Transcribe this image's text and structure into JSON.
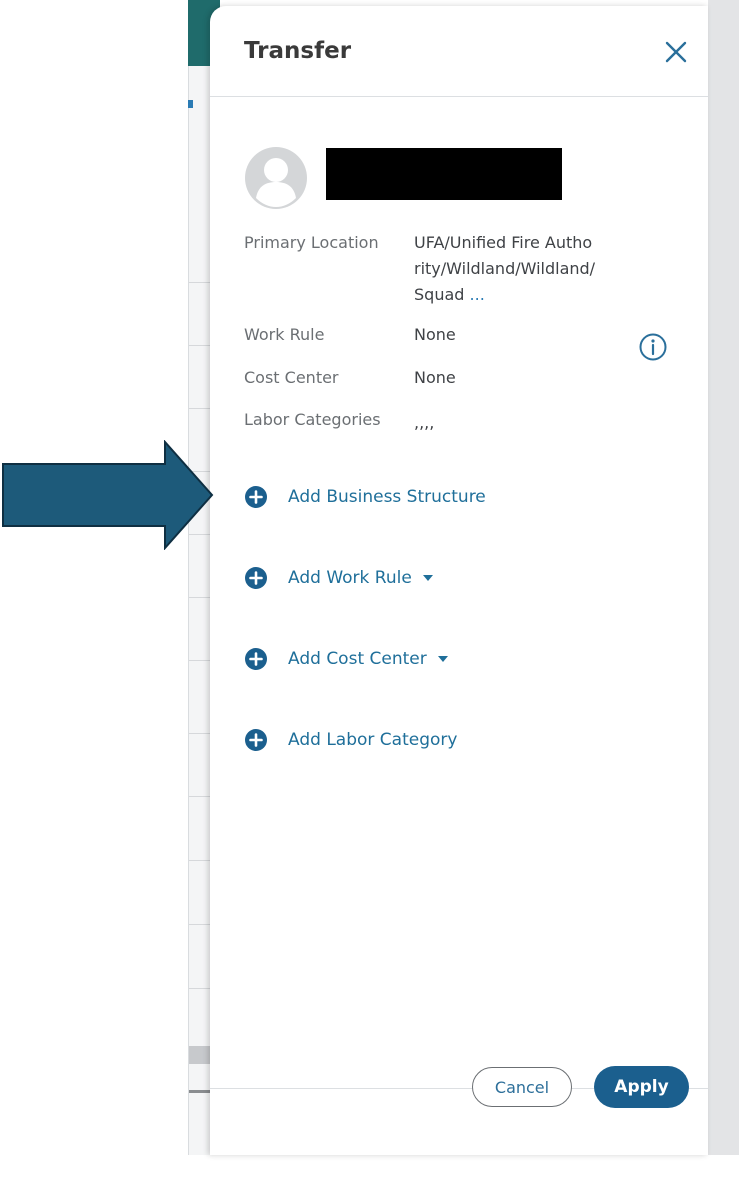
{
  "panel": {
    "title": "Transfer",
    "close_icon": "close-icon"
  },
  "employee": {
    "avatar_icon": "user-avatar-icon",
    "name": "",
    "fields": {
      "primary_location_label": "Primary Location",
      "primary_location_value_lines": [
        "UFA/Unified Fire Autho",
        "rity/Wildland/Wildland/",
        "Squad"
      ],
      "primary_location_more": "...",
      "work_rule_label": "Work Rule",
      "work_rule_value": "None",
      "cost_center_label": "Cost Center",
      "cost_center_value": "None",
      "labor_categories_label": "Labor Categories",
      "labor_categories_value": ",,,,"
    },
    "info_icon": "info-icon"
  },
  "actions": [
    {
      "label": "Add Business Structure",
      "has_dropdown": false
    },
    {
      "label": "Add Work Rule",
      "has_dropdown": true
    },
    {
      "label": "Add Cost Center",
      "has_dropdown": true
    },
    {
      "label": "Add Labor Category",
      "has_dropdown": false
    }
  ],
  "footer": {
    "cancel_label": "Cancel",
    "apply_label": "Apply"
  },
  "colors": {
    "accent": "#1b5f8e",
    "link": "#1f6f9a",
    "arrow": "#1d5a7a",
    "header_teal": "#1f6b6b"
  }
}
